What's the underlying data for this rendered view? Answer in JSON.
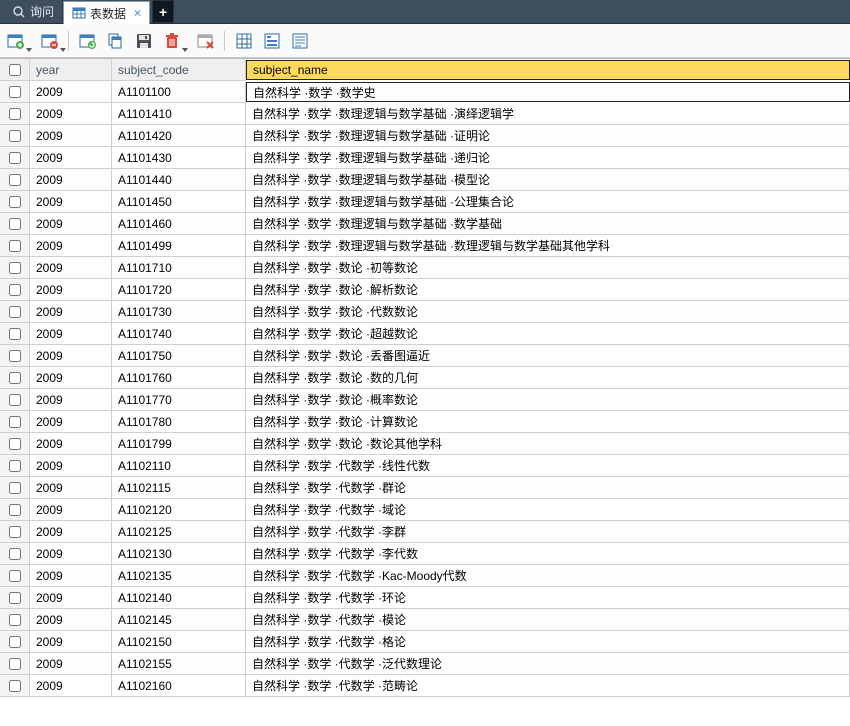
{
  "tabs": {
    "query_label": "询问",
    "tabledata_label": "表数据"
  },
  "columns": {
    "year": "year",
    "subject_code": "subject_code",
    "subject_name": "subject_name"
  },
  "rows": [
    {
      "year": "2009",
      "subject_code": "A1101100",
      "subject_name": "自然科学 ·数学 ·数学史"
    },
    {
      "year": "2009",
      "subject_code": "A1101410",
      "subject_name": "自然科学 ·数学 ·数理逻辑与数学基础 ·演绎逻辑学"
    },
    {
      "year": "2009",
      "subject_code": "A1101420",
      "subject_name": "自然科学 ·数学 ·数理逻辑与数学基础 ·证明论"
    },
    {
      "year": "2009",
      "subject_code": "A1101430",
      "subject_name": "自然科学 ·数学 ·数理逻辑与数学基础 ·递归论"
    },
    {
      "year": "2009",
      "subject_code": "A1101440",
      "subject_name": "自然科学 ·数学 ·数理逻辑与数学基础 ·模型论"
    },
    {
      "year": "2009",
      "subject_code": "A1101450",
      "subject_name": "自然科学 ·数学 ·数理逻辑与数学基础 ·公理集合论"
    },
    {
      "year": "2009",
      "subject_code": "A1101460",
      "subject_name": "自然科学 ·数学 ·数理逻辑与数学基础 ·数学基础"
    },
    {
      "year": "2009",
      "subject_code": "A1101499",
      "subject_name": "自然科学 ·数学 ·数理逻辑与数学基础 ·数理逻辑与数学基础其他学科"
    },
    {
      "year": "2009",
      "subject_code": "A1101710",
      "subject_name": "自然科学 ·数学 ·数论 ·初等数论"
    },
    {
      "year": "2009",
      "subject_code": "A1101720",
      "subject_name": "自然科学 ·数学 ·数论 ·解析数论"
    },
    {
      "year": "2009",
      "subject_code": "A1101730",
      "subject_name": "自然科学 ·数学 ·数论 ·代数数论"
    },
    {
      "year": "2009",
      "subject_code": "A1101740",
      "subject_name": "自然科学 ·数学 ·数论 ·超越数论"
    },
    {
      "year": "2009",
      "subject_code": "A1101750",
      "subject_name": "自然科学 ·数学 ·数论 ·丢番图逼近"
    },
    {
      "year": "2009",
      "subject_code": "A1101760",
      "subject_name": "自然科学 ·数学 ·数论 ·数的几何"
    },
    {
      "year": "2009",
      "subject_code": "A1101770",
      "subject_name": "自然科学 ·数学 ·数论 ·概率数论"
    },
    {
      "year": "2009",
      "subject_code": "A1101780",
      "subject_name": "自然科学 ·数学 ·数论 ·计算数论"
    },
    {
      "year": "2009",
      "subject_code": "A1101799",
      "subject_name": "自然科学 ·数学 ·数论 ·数论其他学科"
    },
    {
      "year": "2009",
      "subject_code": "A1102110",
      "subject_name": "自然科学 ·数学 ·代数学 ·线性代数"
    },
    {
      "year": "2009",
      "subject_code": "A1102115",
      "subject_name": "自然科学 ·数学 ·代数学 ·群论"
    },
    {
      "year": "2009",
      "subject_code": "A1102120",
      "subject_name": "自然科学 ·数学 ·代数学 ·域论"
    },
    {
      "year": "2009",
      "subject_code": "A1102125",
      "subject_name": "自然科学 ·数学 ·代数学 ·李群"
    },
    {
      "year": "2009",
      "subject_code": "A1102130",
      "subject_name": "自然科学 ·数学 ·代数学 ·李代数"
    },
    {
      "year": "2009",
      "subject_code": "A1102135",
      "subject_name": "自然科学 ·数学 ·代数学 ·Kac-Moody代数"
    },
    {
      "year": "2009",
      "subject_code": "A1102140",
      "subject_name": "自然科学 ·数学 ·代数学 ·环论"
    },
    {
      "year": "2009",
      "subject_code": "A1102145",
      "subject_name": "自然科学 ·数学 ·代数学 ·模论"
    },
    {
      "year": "2009",
      "subject_code": "A1102150",
      "subject_name": "自然科学 ·数学 ·代数学 ·格论"
    },
    {
      "year": "2009",
      "subject_code": "A1102155",
      "subject_name": "自然科学 ·数学 ·代数学 ·泛代数理论"
    },
    {
      "year": "2009",
      "subject_code": "A1102160",
      "subject_name": "自然科学 ·数学 ·代数学 ·范畴论"
    }
  ]
}
